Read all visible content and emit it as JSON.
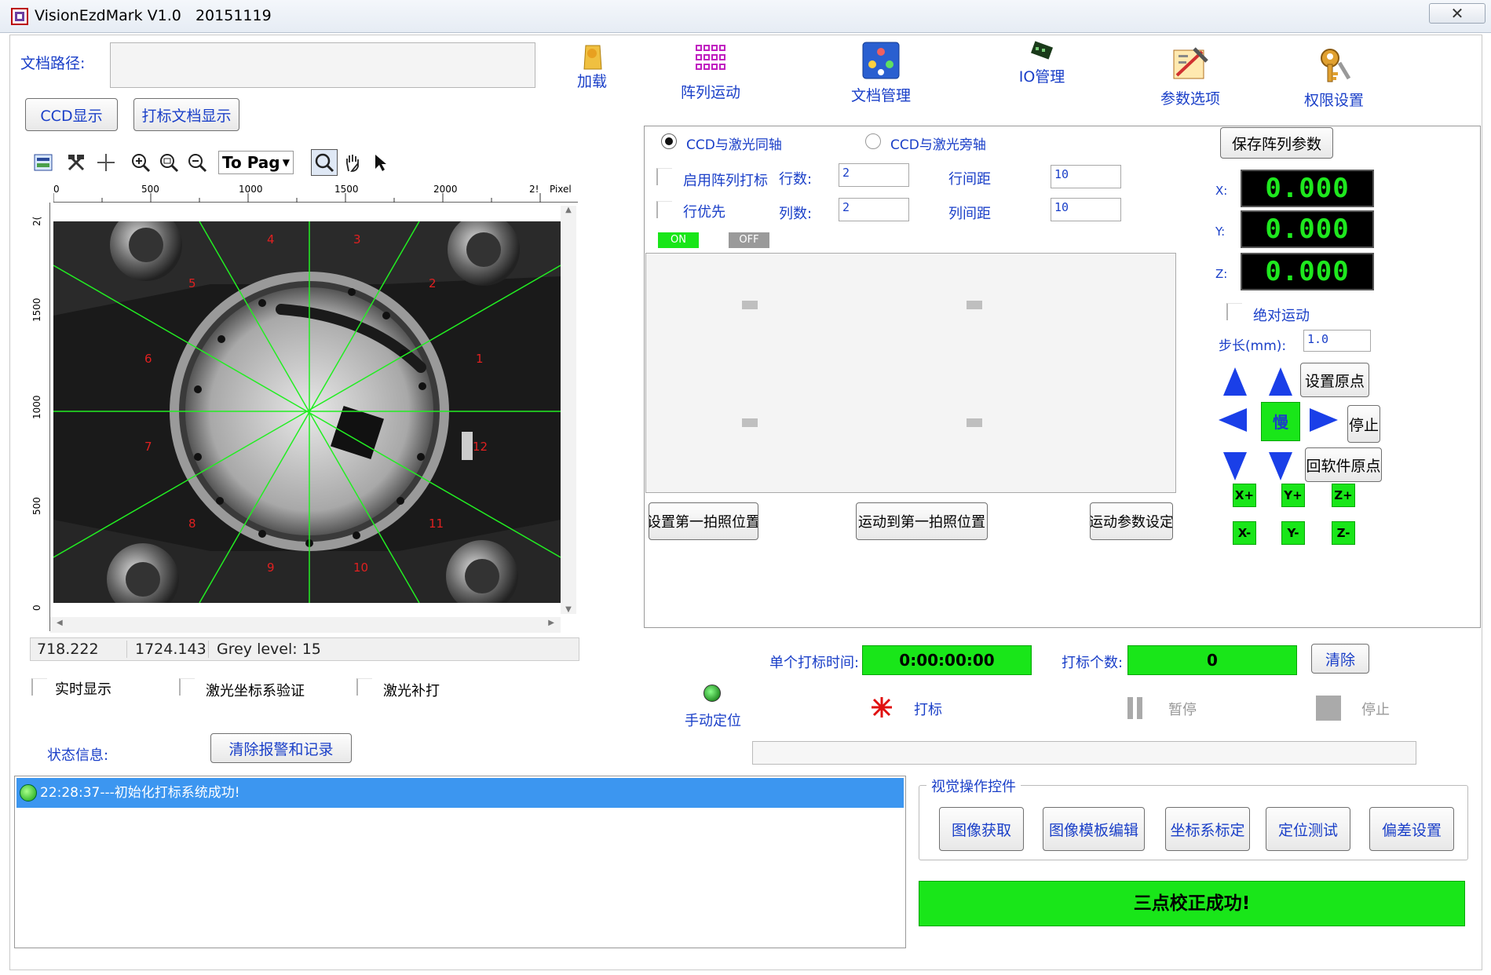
{
  "window": {
    "title": "VisionEzdMark V1.0   20151119",
    "close_glyph": "✕"
  },
  "top": {
    "doc_path_label": "文档路径:",
    "doc_path_value": "",
    "ccd_button": "CCD显示",
    "mark_doc_button": "打标文档显示"
  },
  "toolbar_icons": [
    {
      "label": "加载",
      "icon": "load-icon"
    },
    {
      "label": "阵列运动",
      "icon": "array-motion-icon"
    },
    {
      "label": "文档管理",
      "icon": "doc-manage-icon"
    },
    {
      "label": "IO管理",
      "icon": "io-manage-icon"
    },
    {
      "label": "参数选项",
      "icon": "params-icon"
    },
    {
      "label": "权限设置",
      "icon": "permission-icon"
    }
  ],
  "image_toolbar": {
    "page_dropdown": "To Pag"
  },
  "ruler_h": [
    "0",
    "500",
    "1000",
    "1500",
    "2000",
    "2!",
    "Pixel"
  ],
  "ruler_v": [
    "2(",
    "1500",
    "1000",
    "500",
    "0"
  ],
  "viewer_labels": [
    "1",
    "2",
    "3",
    "4",
    "5",
    "6",
    "7",
    "8",
    "9",
    "10",
    "11",
    "12"
  ],
  "status_bar": {
    "x": "718.222",
    "y": "1724.143",
    "grey": "Grey level: 15"
  },
  "checks": {
    "realtime": "实时显示",
    "laser_coord": "激光坐标系验证",
    "laser_fill": "激光补打"
  },
  "status_info_label": "状态信息:",
  "clear_alarm_button": "清除报警和记录",
  "log": [
    {
      "time": "22:28:37",
      "text": "22:28:37---初始化打标系统成功!"
    }
  ],
  "array_panel": {
    "radio_coaxial": "CCD与激光同轴",
    "radio_side": "CCD与激光旁轴",
    "enable_array": "启用阵列打标",
    "row_priority": "行优先",
    "rows_label": "行数:",
    "rows_value": "2",
    "cols_label": "列数:",
    "cols_value": "2",
    "row_spacing_label": "行间距",
    "row_spacing_value": "10",
    "col_spacing_label": "列间距",
    "col_spacing_value": "10",
    "on": "ON",
    "off": "OFF",
    "set_first_photo": "设置第一拍照位置",
    "move_first_photo": "运动到第一拍照位置",
    "motion_params": "运动参数设定"
  },
  "motion_panel": {
    "save_array_params": "保存阵列参数",
    "x_label": "X:",
    "y_label": "Y:",
    "z_label": "Z:",
    "x_value": "0.000",
    "y_value": "0.000",
    "z_value": "0.000",
    "absolute_motion": "绝对运动",
    "step_label": "步长(mm):",
    "step_value": "1.0",
    "set_origin": "设置原点",
    "stop": "停止",
    "back_soft_origin": "回软件原点",
    "slow": "慢",
    "xp": "X+",
    "yp": "Y+",
    "zp": "Z+",
    "xm": "X-",
    "ym": "Y-",
    "zm": "Z-"
  },
  "mark_area": {
    "single_time_label": "单个打标时间:",
    "single_time_value": "0:00:00:00",
    "count_label": "打标个数:",
    "count_value": "0",
    "clear_button": "清除",
    "manual_locate": "手动定位",
    "mark": "打标",
    "pause": "暂停",
    "stop": "停止"
  },
  "vision_group": {
    "title": "视觉操作控件",
    "buttons": [
      "图像获取",
      "图像模板编辑",
      "坐标系标定",
      "定位测试",
      "偏差设置"
    ]
  },
  "calibration_status": "三点校正成功!",
  "colors": {
    "green": "#19e619",
    "blue_text": "#1a3fc8",
    "log_highlight": "#3c96f0"
  }
}
